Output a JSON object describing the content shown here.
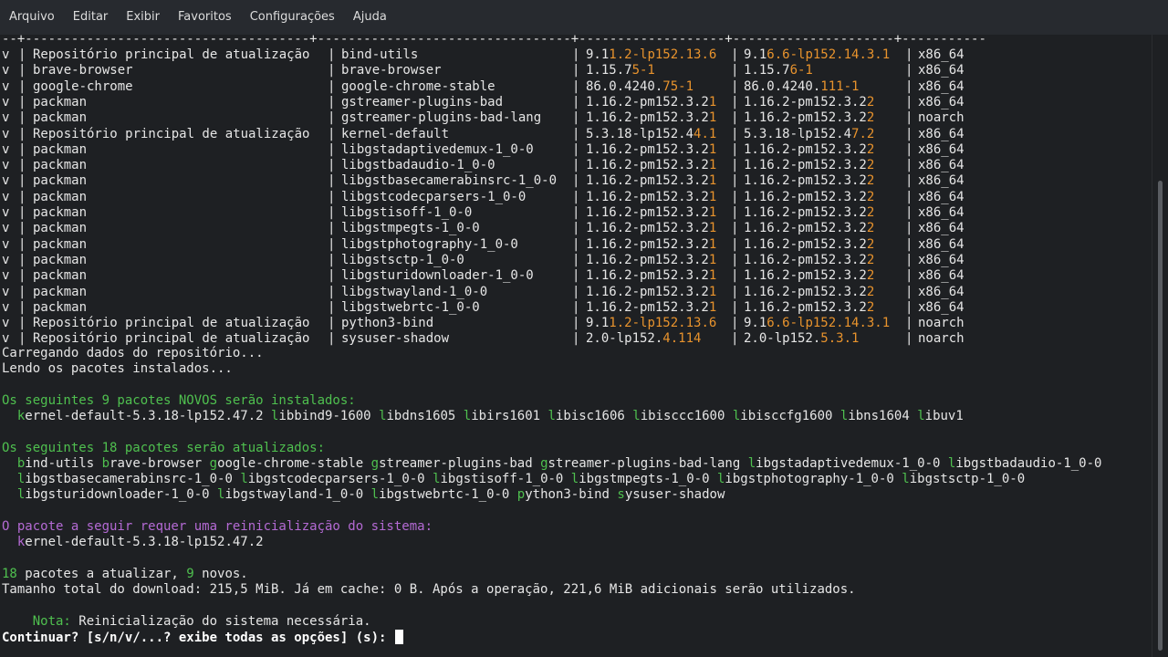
{
  "menubar": [
    "Arquivo",
    "Editar",
    "Exibir",
    "Favoritos",
    "Configurações",
    "Ajuda"
  ],
  "separator": "--+-------------------------------------+---------------------------------+-------------------+---------------------+-----------",
  "rows": [
    {
      "s": "v",
      "repo": "Repositório principal de atualização",
      "name": "bind-utils",
      "cur": [
        "9.1",
        "1.2-lp152.13.6"
      ],
      "new": [
        "9.1",
        "6.6-lp152.14.3.1"
      ],
      "arch": "x86_64"
    },
    {
      "s": "v",
      "repo": "brave-browser",
      "name": "brave-browser",
      "cur": [
        "1.15.7",
        "5-1"
      ],
      "new": [
        "1.15.7",
        "6-1"
      ],
      "arch": "x86_64"
    },
    {
      "s": "v",
      "repo": "google-chrome",
      "name": "google-chrome-stable",
      "cur": [
        "86.0.4240.",
        "75-1"
      ],
      "new": [
        "86.0.4240.",
        "111-1"
      ],
      "arch": "x86_64"
    },
    {
      "s": "v",
      "repo": "packman",
      "name": "gstreamer-plugins-bad",
      "cur": [
        "1.16.2-pm152.3.2",
        "1"
      ],
      "new": [
        "1.16.2-pm152.3.2",
        "2"
      ],
      "arch": "x86_64"
    },
    {
      "s": "v",
      "repo": "packman",
      "name": "gstreamer-plugins-bad-lang",
      "cur": [
        "1.16.2-pm152.3.2",
        "1"
      ],
      "new": [
        "1.16.2-pm152.3.2",
        "2"
      ],
      "arch": "noarch"
    },
    {
      "s": "v",
      "repo": "Repositório principal de atualização",
      "name": "kernel-default",
      "cur": [
        "5.3.18-lp152.4",
        "4.1"
      ],
      "new": [
        "5.3.18-lp152.4",
        "7.2"
      ],
      "arch": "x86_64"
    },
    {
      "s": "v",
      "repo": "packman",
      "name": "libgstadaptivedemux-1_0-0",
      "cur": [
        "1.16.2-pm152.3.2",
        "1"
      ],
      "new": [
        "1.16.2-pm152.3.2",
        "2"
      ],
      "arch": "x86_64"
    },
    {
      "s": "v",
      "repo": "packman",
      "name": "libgstbadaudio-1_0-0",
      "cur": [
        "1.16.2-pm152.3.2",
        "1"
      ],
      "new": [
        "1.16.2-pm152.3.2",
        "2"
      ],
      "arch": "x86_64"
    },
    {
      "s": "v",
      "repo": "packman",
      "name": "libgstbasecamerabinsrc-1_0-0",
      "cur": [
        "1.16.2-pm152.3.2",
        "1"
      ],
      "new": [
        "1.16.2-pm152.3.2",
        "2"
      ],
      "arch": "x86_64"
    },
    {
      "s": "v",
      "repo": "packman",
      "name": "libgstcodecparsers-1_0-0",
      "cur": [
        "1.16.2-pm152.3.2",
        "1"
      ],
      "new": [
        "1.16.2-pm152.3.2",
        "2"
      ],
      "arch": "x86_64"
    },
    {
      "s": "v",
      "repo": "packman",
      "name": "libgstisoff-1_0-0",
      "cur": [
        "1.16.2-pm152.3.2",
        "1"
      ],
      "new": [
        "1.16.2-pm152.3.2",
        "2"
      ],
      "arch": "x86_64"
    },
    {
      "s": "v",
      "repo": "packman",
      "name": "libgstmpegts-1_0-0",
      "cur": [
        "1.16.2-pm152.3.2",
        "1"
      ],
      "new": [
        "1.16.2-pm152.3.2",
        "2"
      ],
      "arch": "x86_64"
    },
    {
      "s": "v",
      "repo": "packman",
      "name": "libgstphotography-1_0-0",
      "cur": [
        "1.16.2-pm152.3.2",
        "1"
      ],
      "new": [
        "1.16.2-pm152.3.2",
        "2"
      ],
      "arch": "x86_64"
    },
    {
      "s": "v",
      "repo": "packman",
      "name": "libgstsctp-1_0-0",
      "cur": [
        "1.16.2-pm152.3.2",
        "1"
      ],
      "new": [
        "1.16.2-pm152.3.2",
        "2"
      ],
      "arch": "x86_64"
    },
    {
      "s": "v",
      "repo": "packman",
      "name": "libgsturidownloader-1_0-0",
      "cur": [
        "1.16.2-pm152.3.2",
        "1"
      ],
      "new": [
        "1.16.2-pm152.3.2",
        "2"
      ],
      "arch": "x86_64"
    },
    {
      "s": "v",
      "repo": "packman",
      "name": "libgstwayland-1_0-0",
      "cur": [
        "1.16.2-pm152.3.2",
        "1"
      ],
      "new": [
        "1.16.2-pm152.3.2",
        "2"
      ],
      "arch": "x86_64"
    },
    {
      "s": "v",
      "repo": "packman",
      "name": "libgstwebrtc-1_0-0",
      "cur": [
        "1.16.2-pm152.3.2",
        "1"
      ],
      "new": [
        "1.16.2-pm152.3.2",
        "2"
      ],
      "arch": "x86_64"
    },
    {
      "s": "v",
      "repo": "Repositório principal de atualização",
      "name": "python3-bind",
      "cur": [
        "9.1",
        "1.2-lp152.13.6"
      ],
      "new": [
        "9.1",
        "6.6-lp152.14.3.1"
      ],
      "arch": "noarch"
    },
    {
      "s": "v",
      "repo": "Repositório principal de atualização",
      "name": "sysuser-shadow",
      "cur": [
        "2.0-lp152.",
        "4.114"
      ],
      "new": [
        "2.0-lp152.",
        "5.3.1"
      ],
      "arch": "noarch"
    }
  ],
  "loading_line": "Carregando dados do repositório...",
  "reading_line": "Lendo os pacotes instalados...",
  "new_heading": "Os seguintes 9 pacotes NOVOS serão instalados:",
  "new_packages": [
    "kernel-default-5.3.18-lp152.47.2",
    "libbind9-1600",
    "libdns1605",
    "libirs1601",
    "libisc1606",
    "libisccc1600",
    "libisccfg1600",
    "libns1604",
    "libuv1"
  ],
  "upgrade_heading": "Os seguintes 18 pacotes serão atualizados:",
  "upgrade_lines": [
    [
      "bind-utils",
      "brave-browser",
      "google-chrome-stable",
      "gstreamer-plugins-bad",
      "gstreamer-plugins-bad-lang",
      "libgstadaptivedemux-1_0-0",
      "libgstbadaudio-1_0-0"
    ],
    [
      "libgstbasecamerabinsrc-1_0-0",
      "libgstcodecparsers-1_0-0",
      "libgstisoff-1_0-0",
      "libgstmpegts-1_0-0",
      "libgstphotography-1_0-0",
      "libgstsctp-1_0-0"
    ],
    [
      "libgsturidownloader-1_0-0",
      "libgstwayland-1_0-0",
      "libgstwebrtc-1_0-0",
      "python3-bind",
      "sysuser-shadow"
    ]
  ],
  "reboot_heading": "O pacote a seguir requer uma reinicialização do sistema:",
  "reboot_package": "kernel-default-5.3.18-lp152.47.2",
  "summary": {
    "upgrade_count": "18",
    "upgrade_text": " pacotes a atualizar, ",
    "new_count": "9",
    "new_text": " novos."
  },
  "download_line": "Tamanho total do download: 215,5 MiB. Já em cache: 0 B. Após a operação, 221,6 MiB adicionais serão utilizados.",
  "note_label": "Nota:",
  "note_text": " Reinicialização do sistema necessária.",
  "prompt": "Continuar? [s/n/v/...? exibe todas as opções] (s): ",
  "colors": {
    "orange": "#e8932d",
    "green": "#4fc04f",
    "purple": "#b46ad4",
    "text": "#e6e6e6",
    "background": "#1e2023"
  }
}
